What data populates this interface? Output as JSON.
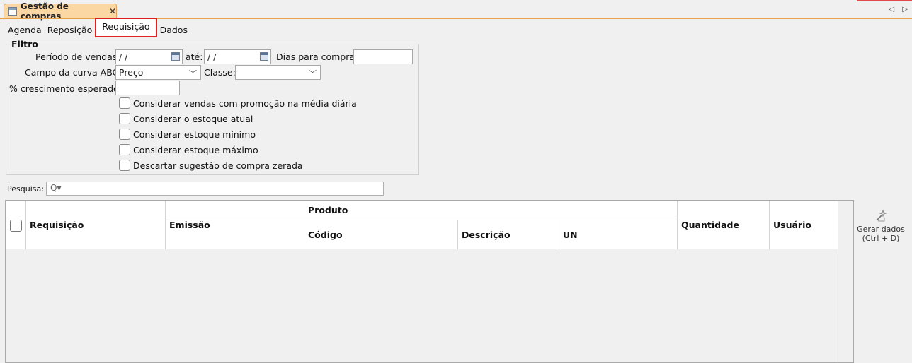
{
  "window": {
    "tab_title": "Gestão de compras",
    "close_glyph": "✕",
    "nav_arrows": "◁ ▷"
  },
  "tabs": [
    {
      "label": "Agenda"
    },
    {
      "label": "Reposição"
    },
    {
      "label": "Requisição"
    },
    {
      "label": "Dados"
    }
  ],
  "filter": {
    "title": "Filtro",
    "periodo_label": "Período de vendas:",
    "periodo_inicio": " /  /",
    "ate_label": "até:",
    "periodo_fim": " /  /",
    "dias_label": "Dias para compra:",
    "dias_value": "",
    "curva_label": "Campo da curva ABC:",
    "curva_value": "Preço",
    "classe_label": "Classe:",
    "classe_value": "",
    "crescimento_label": "% crescimento esperado:",
    "crescimento_value": "",
    "checkboxes": [
      {
        "label": "Considerar vendas com promoção na média diária",
        "checked": false
      },
      {
        "label": "Considerar o estoque atual",
        "checked": false
      },
      {
        "label": "Considerar estoque mínimo",
        "checked": false
      },
      {
        "label": "Considerar estoque máximo",
        "checked": false
      },
      {
        "label": "Descartar sugestão de compra zerada",
        "checked": false
      }
    ]
  },
  "search": {
    "label": "Pesquisa:",
    "value": "",
    "icon": "Q▾"
  },
  "grid": {
    "columns": {
      "requisicao": "Requisição",
      "emissao": "Emissão",
      "produto": "Produto",
      "codigo": "Código",
      "descricao": "Descrição",
      "un": "UN",
      "quantidade": "Quantidade",
      "usuario": "Usuário"
    },
    "rows": []
  },
  "actions": {
    "gerar_dados_line1": "Gerar dados",
    "gerar_dados_line2": "(Ctrl + D)"
  },
  "colors": {
    "accent_orange": "#e8a04c",
    "tab_bg": "#fbd7a4",
    "highlight_red": "#e02020"
  }
}
